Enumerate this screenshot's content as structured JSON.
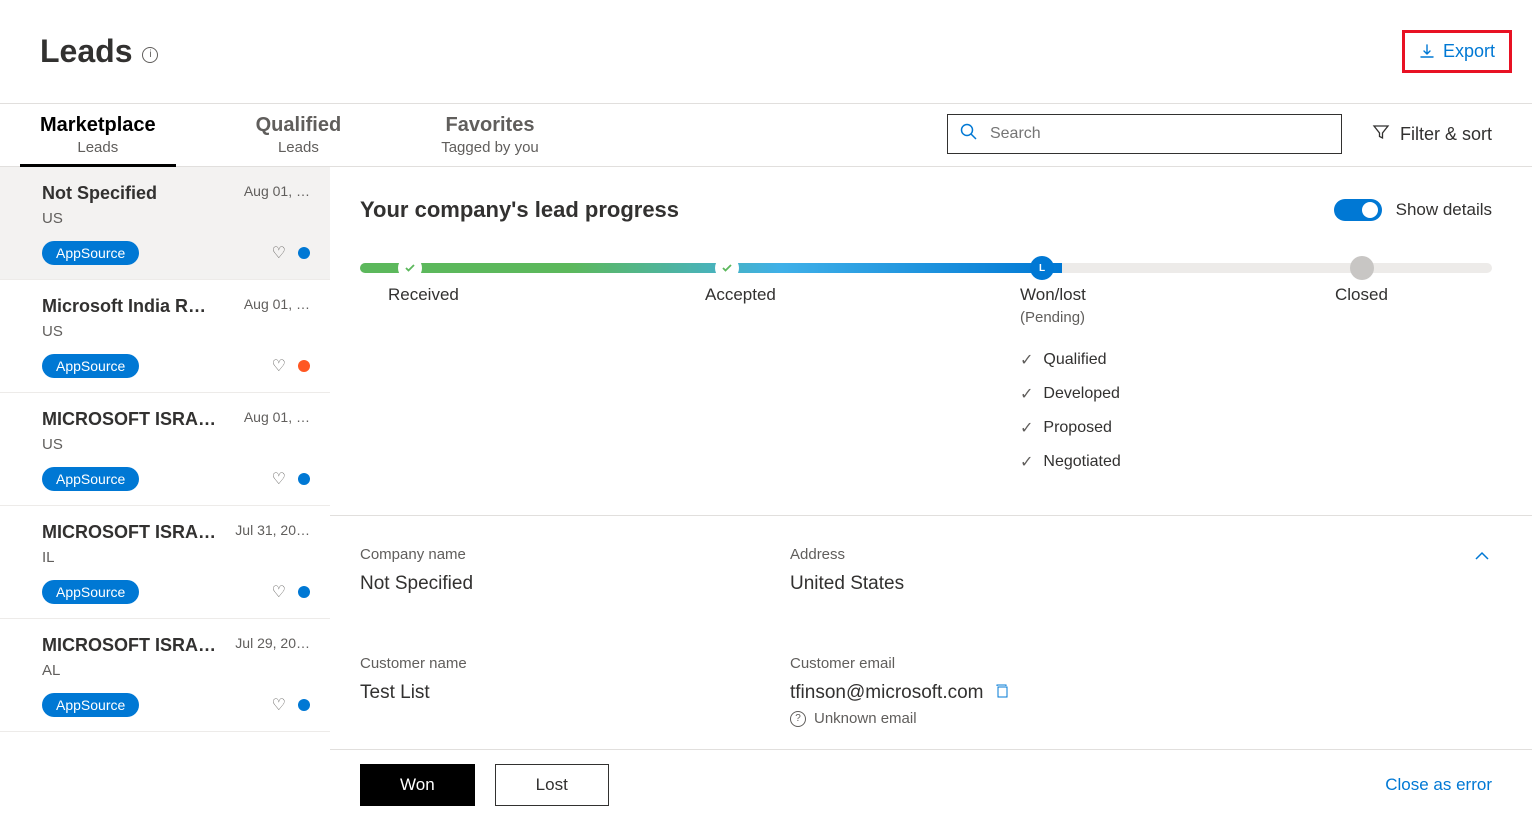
{
  "header": {
    "title": "Leads",
    "export": "Export"
  },
  "tabs": [
    {
      "title": "Marketplace",
      "sub": "Leads",
      "active": true
    },
    {
      "title": "Qualified",
      "sub": "Leads",
      "active": false
    },
    {
      "title": "Favorites",
      "sub": "Tagged by you",
      "active": false
    }
  ],
  "search": {
    "placeholder": "Search"
  },
  "filter_sort": "Filter & sort",
  "leads": [
    {
      "name": "Not Specified",
      "date": "Aug 01, …",
      "sub": "US",
      "badge": "AppSource",
      "dot": "blue",
      "selected": true
    },
    {
      "name": "Microsoft India R&…",
      "date": "Aug 01, …",
      "sub": "US",
      "badge": "AppSource",
      "dot": "orange",
      "selected": false
    },
    {
      "name": "MICROSOFT ISRAE…",
      "date": "Aug 01, …",
      "sub": "US",
      "badge": "AppSource",
      "dot": "blue",
      "selected": false
    },
    {
      "name": "MICROSOFT ISRAE…",
      "date": "Jul 31, 20…",
      "sub": "IL",
      "badge": "AppSource",
      "dot": "blue",
      "selected": false
    },
    {
      "name": "MICROSOFT ISRAE…",
      "date": "Jul 29, 20…",
      "sub": "AL",
      "badge": "AppSource",
      "dot": "blue",
      "selected": false
    }
  ],
  "progress": {
    "title": "Your company's lead progress",
    "toggle_label": "Show details",
    "stages": {
      "received": "Received",
      "accepted": "Accepted",
      "wonlost": "Won/lost",
      "wonlost_sub": "(Pending)",
      "closed": "Closed"
    },
    "substages": [
      "Qualified",
      "Developed",
      "Proposed",
      "Negotiated"
    ]
  },
  "info": {
    "company_label": "Company name",
    "company_value": "Not Specified",
    "address_label": "Address",
    "address_value": "United States",
    "customer_name_label": "Customer name",
    "customer_name_value": "Test List",
    "customer_email_label": "Customer email",
    "customer_email_value": "tfinson@microsoft.com",
    "unknown_email": "Unknown email"
  },
  "actions": {
    "won": "Won",
    "lost": "Lost",
    "close_error": "Close as error"
  }
}
